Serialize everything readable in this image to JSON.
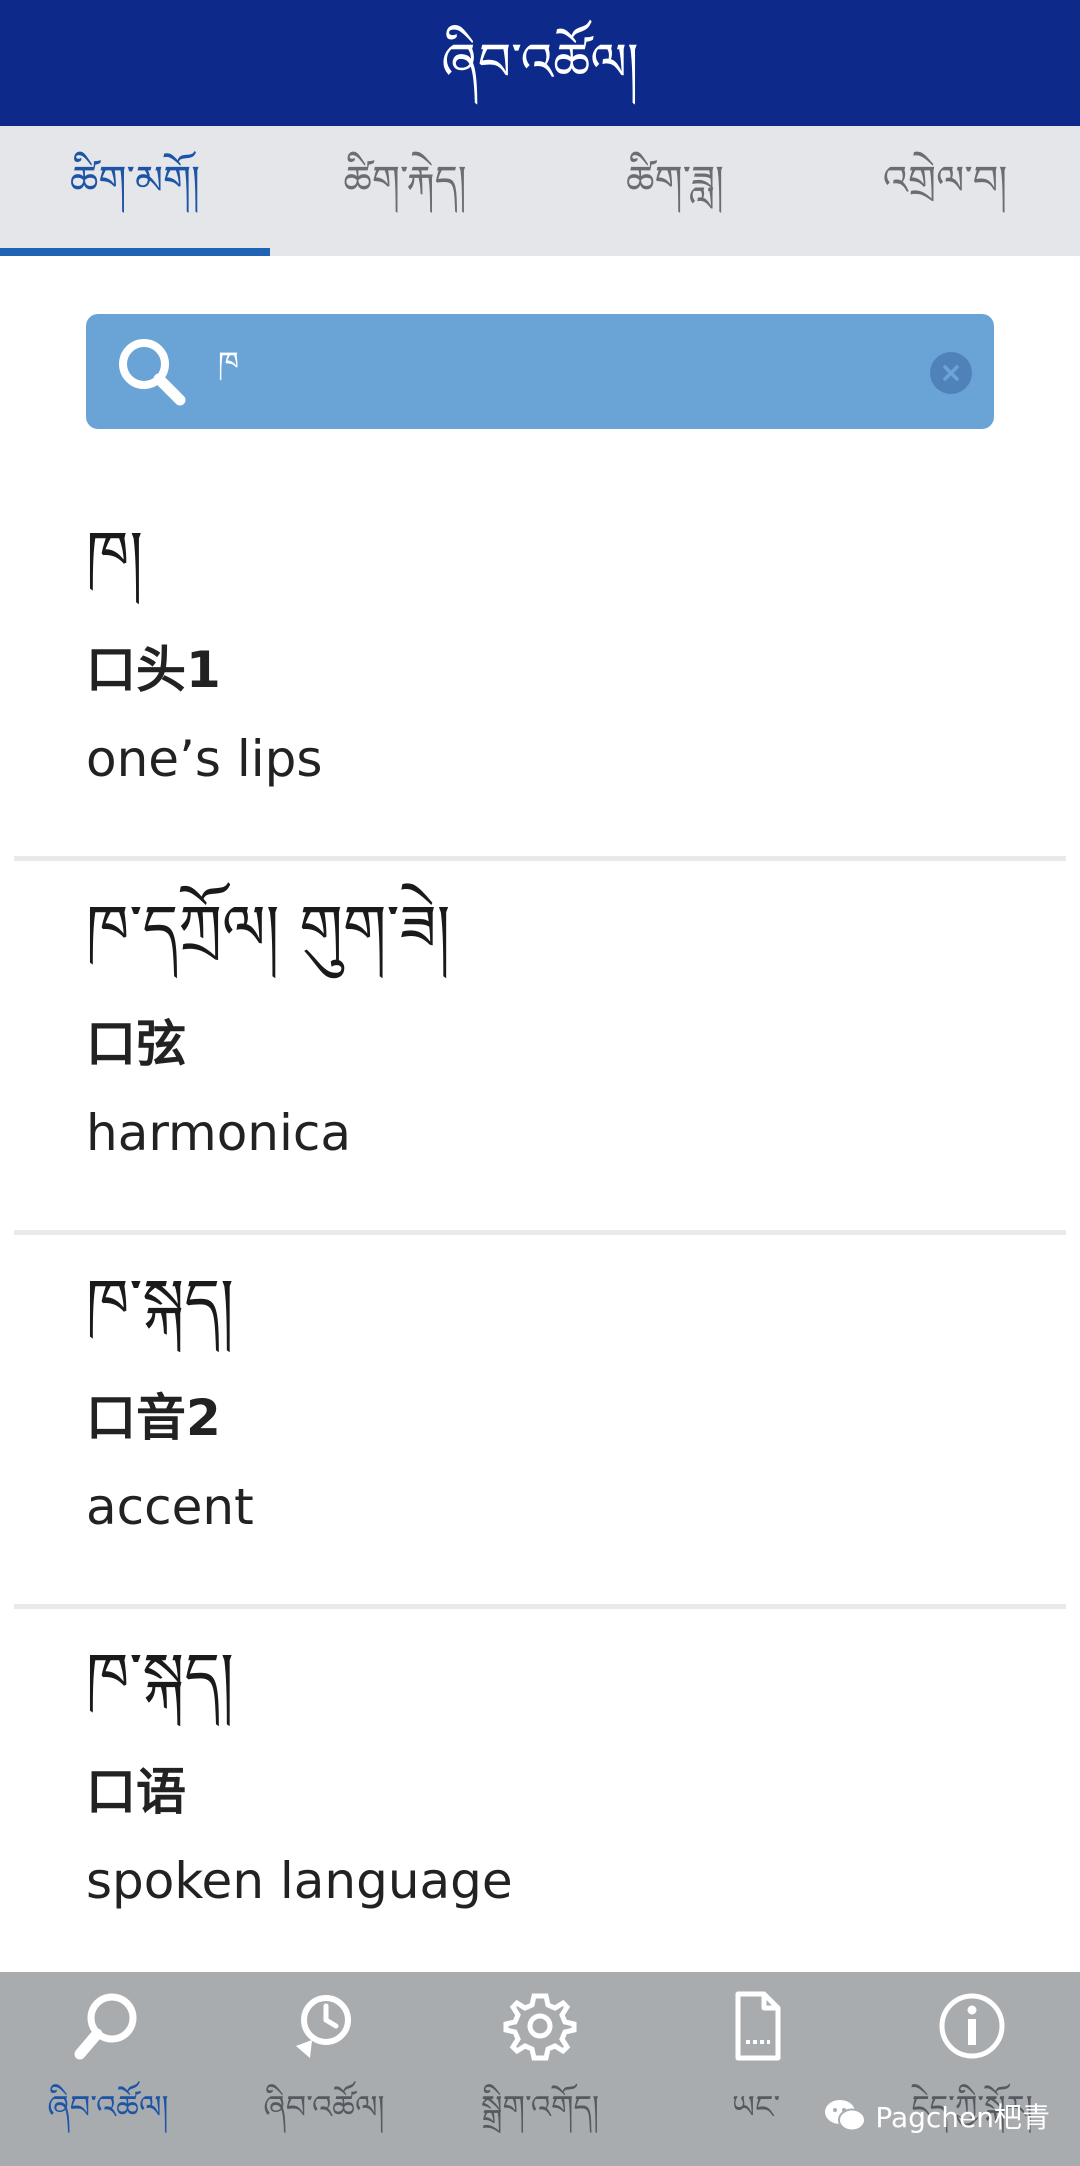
{
  "header": {
    "title": "ཞིབ་འཚོལ།"
  },
  "tabs": [
    {
      "label": "ཚིག་མགོ།",
      "active": true
    },
    {
      "label": "ཚིག་རྐེད།",
      "active": false
    },
    {
      "label": "ཚིག་ཟླ།",
      "active": false
    },
    {
      "label": "འགྲེལ་བ།",
      "active": false
    }
  ],
  "search": {
    "value": "ཁ",
    "placeholder": ""
  },
  "results": [
    {
      "tibetan": "ཁ།",
      "chinese": "口头1",
      "english": "one’s lips"
    },
    {
      "tibetan": "ཁ་དཀྲོལ། གུག་ཟེ།",
      "chinese": "口弦",
      "english": "harmonica"
    },
    {
      "tibetan": "ཁ་སྐད།",
      "chinese": "口音2",
      "english": "accent"
    },
    {
      "tibetan": "ཁ་སྐད།",
      "chinese": "口语",
      "english": "spoken language"
    }
  ],
  "bottom_nav": [
    {
      "label": "ཞིབ་འཚོལ།",
      "icon": "search-icon",
      "active": true
    },
    {
      "label": "ཞིབ་འཚོལ།",
      "icon": "history-icon",
      "active": false
    },
    {
      "label": "སྒྲིག་འགོད།",
      "icon": "gear-icon",
      "active": false
    },
    {
      "label": "ཡང་",
      "icon": "document-icon",
      "active": false
    },
    {
      "label": "ངེད་ཀྱི་སྐོར།",
      "icon": "info-icon",
      "active": false
    }
  ],
  "watermark": {
    "text": "Pagchen杷青"
  },
  "colors": {
    "header_bg": "#0d2a8a",
    "tab_bg": "#e4e6e9",
    "accent": "#1f63b5",
    "search_bg": "#6aa3d6",
    "bottom_nav_bg": "#a9acaf"
  }
}
